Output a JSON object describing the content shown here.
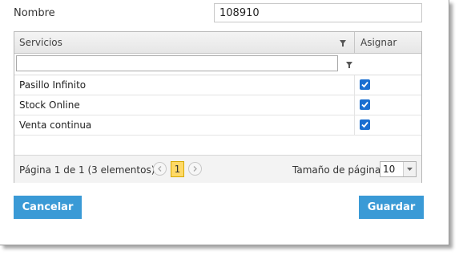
{
  "form": {
    "name_label": "Nombre",
    "name_value": "108910"
  },
  "grid": {
    "columns": {
      "servicios": "Servicios",
      "asignar": "Asignar"
    },
    "filter_value": "",
    "rows": [
      {
        "servicio": "Pasillo Infinito",
        "asignado": true
      },
      {
        "servicio": "Stock Online",
        "asignado": true
      },
      {
        "servicio": "Venta continua",
        "asignado": true
      }
    ],
    "pager": {
      "info": "Página 1 de 1 (3 elementos)",
      "current_page": "1",
      "page_size_label": "Tamaño de página:",
      "page_size": "10"
    }
  },
  "buttons": {
    "cancel": "Cancelar",
    "save": "Guardar"
  },
  "colors": {
    "button": "#3a9ad6",
    "checkbox": "#1a6fd1",
    "current_page": "#ffd966"
  },
  "icons": {
    "filter": "filter-icon",
    "prev": "chevron-left-icon",
    "next": "chevron-right-icon",
    "dropdown": "chevron-down-icon",
    "check": "checkmark-icon"
  }
}
